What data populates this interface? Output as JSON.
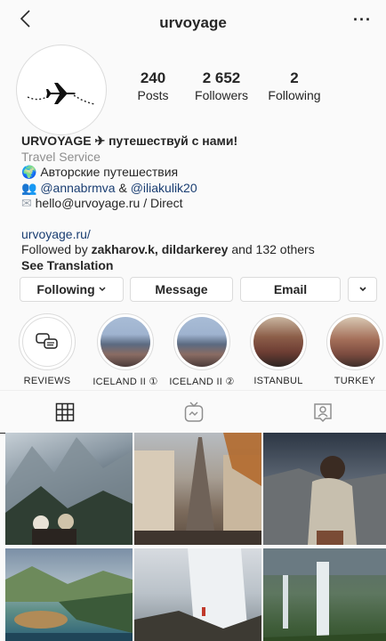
{
  "header": {
    "username": "urvoyage"
  },
  "profile": {
    "stats": [
      {
        "value": "240",
        "label": "Posts"
      },
      {
        "value": "2 652",
        "label": "Followers"
      },
      {
        "value": "2",
        "label": "Following"
      }
    ],
    "bio": {
      "name": "URVOYAGE ✈ путешествуй с нами!",
      "category": "Travel Service",
      "line1": "Авторские путешествия",
      "mention1": "@annabrmva",
      "amp": "&",
      "mention2": "@iliakulik20",
      "email_line": "hello@urvoyage.ru / Direct",
      "website": "urvoyage.ru/",
      "followed_prefix": "Followed by",
      "followed_names": "zakharov.k, dildarkerey",
      "followed_suffix": "and 132 others",
      "see_translation": "See Translation"
    }
  },
  "actions": {
    "following": "Following",
    "message": "Message",
    "email": "Email"
  },
  "highlights": [
    {
      "label": "REVIEWS"
    },
    {
      "label": "ICELAND II ①"
    },
    {
      "label": "ICELAND II ②"
    },
    {
      "label": "ISTANBUL"
    },
    {
      "label": "TURKEY"
    }
  ],
  "icons": {
    "back": "chevron-left-icon",
    "more": "more-horizontal-icon",
    "grid_tab": "grid-icon",
    "igtv_tab": "igtv-icon",
    "tagged_tab": "tagged-person-icon"
  },
  "colors": {
    "link": "#1a3e72",
    "muted": "#8e8e8e",
    "text": "#262626"
  }
}
